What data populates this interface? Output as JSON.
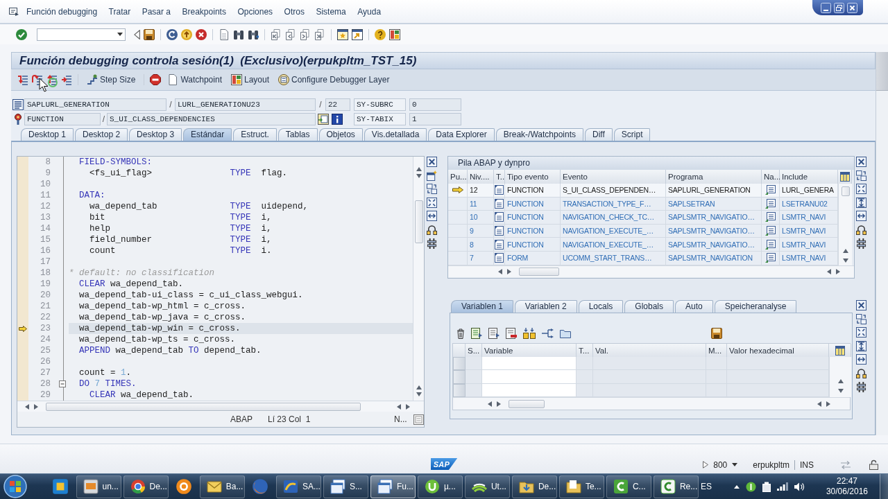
{
  "menu_bar": [
    "Función debugging",
    "Tratar",
    "Pasar a",
    "Breakpoints",
    "Opciones",
    "Otros",
    "Sistema",
    "Ayuda"
  ],
  "window": {
    "title": "Función debugging controla sesión(1)  (Exclusivo)(erpukpltm_TST_15)"
  },
  "app_toolbar": [
    {
      "label": "Step Size"
    },
    {
      "label": "Watchpoint"
    },
    {
      "label": "Layout"
    },
    {
      "label": "Configure Debugger Layer"
    }
  ],
  "position": [
    {
      "kind": "program",
      "parts": [
        "SAPLURL_GENERATION",
        "/",
        "LURL_GENERATIONU23",
        "/",
        "22"
      ],
      "sys_field": "SY-SUBRC",
      "sys_value": "0"
    },
    {
      "kind": "event",
      "parts": [
        "FUNCTION",
        "/",
        "S_UI_CLASS_DEPENDENCIES"
      ],
      "sys_field": "SY-TABIX",
      "sys_value": "1"
    }
  ],
  "tabs": [
    {
      "label": "Desktop 1",
      "selected": false
    },
    {
      "label": "Desktop 2",
      "selected": false
    },
    {
      "label": "Desktop 3",
      "selected": false
    },
    {
      "label": "Estándar",
      "selected": true
    },
    {
      "label": "Estruct.",
      "selected": false
    },
    {
      "label": "Tablas",
      "selected": false
    },
    {
      "label": "Objetos",
      "selected": false
    },
    {
      "label": "Vis.detallada",
      "selected": false
    },
    {
      "label": "Data Explorer",
      "selected": false
    },
    {
      "label": "Break-/Watchpoints",
      "selected": false
    },
    {
      "label": "Diff",
      "selected": false
    },
    {
      "label": "Script",
      "selected": false
    }
  ],
  "source_editor": {
    "lines": [
      {
        "number": "8",
        "current": false,
        "foldable": false,
        "segments": [
          {
            "kind": "keyword",
            "text": "  FIELD-SYMBOLS:"
          }
        ]
      },
      {
        "number": "9",
        "current": false,
        "foldable": false,
        "segments": [
          {
            "kind": "plain",
            "text": "    <fs_ui_flag>               "
          },
          {
            "kind": "keyword",
            "text": "TYPE"
          },
          {
            "kind": "plain",
            "text": "  flag."
          }
        ]
      },
      {
        "number": "10",
        "current": false,
        "foldable": false
      },
      {
        "number": "11",
        "current": false,
        "foldable": false,
        "segments": [
          {
            "kind": "keyword",
            "text": "  DATA:"
          }
        ]
      },
      {
        "number": "12",
        "current": false,
        "foldable": false,
        "segments": [
          {
            "kind": "plain",
            "text": "    wa_depend_tab              "
          },
          {
            "kind": "keyword",
            "text": "TYPE"
          },
          {
            "kind": "plain",
            "text": "  uidepend,"
          }
        ]
      },
      {
        "number": "13",
        "current": false,
        "foldable": false,
        "segments": [
          {
            "kind": "plain",
            "text": "    bit                        "
          },
          {
            "kind": "keyword",
            "text": "TYPE"
          },
          {
            "kind": "plain",
            "text": "  i,"
          }
        ]
      },
      {
        "number": "14",
        "current": false,
        "foldable": false,
        "segments": [
          {
            "kind": "plain",
            "text": "    help                       "
          },
          {
            "kind": "keyword",
            "text": "TYPE"
          },
          {
            "kind": "plain",
            "text": "  i,"
          }
        ]
      },
      {
        "number": "15",
        "current": false,
        "foldable": false,
        "segments": [
          {
            "kind": "plain",
            "text": "    field_number               "
          },
          {
            "kind": "keyword",
            "text": "TYPE"
          },
          {
            "kind": "plain",
            "text": "  i,"
          }
        ]
      },
      {
        "number": "16",
        "current": false,
        "foldable": false,
        "segments": [
          {
            "kind": "plain",
            "text": "    count                      "
          },
          {
            "kind": "keyword",
            "text": "TYPE"
          },
          {
            "kind": "plain",
            "text": "  i."
          }
        ]
      },
      {
        "number": "17",
        "current": false,
        "foldable": false
      },
      {
        "number": "18",
        "current": false,
        "foldable": false,
        "segments": [
          {
            "kind": "comment",
            "text": "* default: no classification"
          }
        ]
      },
      {
        "number": "19",
        "current": false,
        "foldable": false,
        "segments": [
          {
            "kind": "keyword",
            "text": "  CLEAR"
          },
          {
            "kind": "plain",
            "text": " wa_depend_tab."
          }
        ]
      },
      {
        "number": "20",
        "current": false,
        "foldable": false,
        "segments": [
          {
            "kind": "plain",
            "text": "  wa_depend_tab-ui_class = c_ui_class_webgui."
          }
        ]
      },
      {
        "number": "21",
        "current": false,
        "foldable": false,
        "segments": [
          {
            "kind": "plain",
            "text": "  wa_depend_tab-wp_html = c_cross."
          }
        ]
      },
      {
        "number": "22",
        "current": false,
        "foldable": false,
        "segments": [
          {
            "kind": "plain",
            "text": "  wa_depend_tab-wp_java = c_cross."
          }
        ]
      },
      {
        "number": "23",
        "current": true,
        "foldable": false,
        "segments": [
          {
            "kind": "plain",
            "text": "  wa_depend_tab-wp_win = c_cross."
          }
        ]
      },
      {
        "number": "24",
        "current": false,
        "foldable": false,
        "segments": [
          {
            "kind": "plain",
            "text": "  wa_depend_tab-wp_ts = c_cross."
          }
        ]
      },
      {
        "number": "25",
        "current": false,
        "foldable": false,
        "segments": [
          {
            "kind": "keyword",
            "text": "  APPEND"
          },
          {
            "kind": "plain",
            "text": " wa_depend_tab "
          },
          {
            "kind": "keyword",
            "text": "TO"
          },
          {
            "kind": "plain",
            "text": " depend_tab."
          }
        ]
      },
      {
        "number": "26",
        "current": false,
        "foldable": false
      },
      {
        "number": "27",
        "current": false,
        "foldable": false,
        "segments": [
          {
            "kind": "plain",
            "text": "  count = "
          },
          {
            "kind": "number",
            "text": "1"
          },
          {
            "kind": "plain",
            "text": "."
          }
        ]
      },
      {
        "number": "28",
        "current": false,
        "foldable": true,
        "segments": [
          {
            "kind": "keyword",
            "text": "  DO "
          },
          {
            "kind": "number",
            "text": "7"
          },
          {
            "kind": "keyword",
            "text": " TIMES."
          }
        ]
      },
      {
        "number": "29",
        "current": false,
        "foldable": false,
        "segments": [
          {
            "kind": "keyword",
            "text": "    CLEAR"
          },
          {
            "kind": "plain",
            "text": " wa_depend_tab."
          }
        ]
      }
    ],
    "status": {
      "language": "ABAP",
      "cursor": "Lí 23 Col  1",
      "mode": "N..."
    }
  },
  "call_stack": {
    "title": "Pila ABAP y dynpro",
    "columns": [
      "Pu...",
      "Niv....",
      "T..",
      "Tipo evento",
      "Evento",
      "Programa",
      "Na...",
      "Include"
    ],
    "rows": [
      {
        "current": true,
        "stack_level": "12",
        "event_type": "FUNCTION",
        "event": "S_UI_CLASS_DEPENDEN…",
        "program": "SAPLURL_GENERATION",
        "include": "LURL_GENERA"
      },
      {
        "current": false,
        "stack_level": "11",
        "event_type": "FUNCTION",
        "event": "TRANSACTION_TYPE_F…",
        "program": "SAPLSETRAN",
        "include": "LSETRANU02"
      },
      {
        "current": false,
        "stack_level": "10",
        "event_type": "FUNCTION",
        "event": "NAVIGATION_CHECK_TC…",
        "program": "SAPLSMTR_NAVIGATIO…",
        "include": "LSMTR_NAVI"
      },
      {
        "current": false,
        "stack_level": "9",
        "event_type": "FUNCTION",
        "event": "NAVIGATION_EXECUTE_…",
        "program": "SAPLSMTR_NAVIGATIO…",
        "include": "LSMTR_NAVI"
      },
      {
        "current": false,
        "stack_level": "8",
        "event_type": "FUNCTION",
        "event": "NAVIGATION_EXECUTE_…",
        "program": "SAPLSMTR_NAVIGATIO…",
        "include": "LSMTR_NAVI"
      },
      {
        "current": false,
        "stack_level": "7",
        "event_type": "FORM",
        "event": "UCOMM_START_TRANS…",
        "program": "SAPLSMTR_NAVIGATION",
        "include": "LSMTR_NAVI"
      }
    ]
  },
  "variables": {
    "tabs": [
      {
        "label": "Variablen 1",
        "selected": true
      },
      {
        "label": "Variablen 2",
        "selected": false
      },
      {
        "label": "Locals",
        "selected": false
      },
      {
        "label": "Globals",
        "selected": false
      },
      {
        "label": "Auto",
        "selected": false
      },
      {
        "label": "Speicheranalyse",
        "selected": false
      }
    ],
    "columns": [
      "S...",
      "Variable",
      "T...",
      "Val.",
      "M...",
      "Valor hexadecimal"
    ]
  },
  "status_bar": {
    "logo": "SAP",
    "client": "800",
    "user": "erpukpltm",
    "mode": "INS"
  },
  "taskbar": {
    "items": [
      {
        "kind": "icon",
        "selected": false
      },
      {
        "kind": "window",
        "label": "un...",
        "selected": false
      },
      {
        "kind": "window",
        "label": "De...",
        "selected": false
      },
      {
        "kind": "icon",
        "selected": false
      },
      {
        "kind": "window",
        "label": "Ba...",
        "selected": false
      },
      {
        "kind": "icon",
        "selected": false
      },
      {
        "kind": "window",
        "label": "SA...",
        "selected": false
      },
      {
        "kind": "window",
        "label": "S...",
        "selected": false
      },
      {
        "kind": "window",
        "label": "Fu...",
        "selected": true
      },
      {
        "kind": "window",
        "label": "µ...",
        "selected": false
      },
      {
        "kind": "window",
        "label": "Ut...",
        "selected": false
      },
      {
        "kind": "window",
        "label": "De...",
        "selected": false
      },
      {
        "kind": "window",
        "label": "Te...",
        "selected": false
      },
      {
        "kind": "window",
        "label": "C...",
        "selected": false
      },
      {
        "kind": "window",
        "label": "Re...",
        "selected": false
      }
    ],
    "language": "ES",
    "time": "22:47",
    "date": "30/06/2016"
  }
}
